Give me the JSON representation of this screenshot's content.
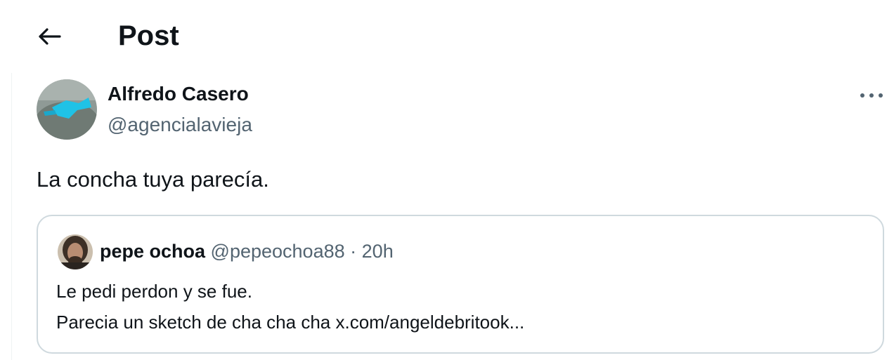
{
  "header": {
    "title": "Post",
    "back_icon": "arrow-left-icon"
  },
  "post": {
    "author_name": "Alfredo Casero",
    "author_handle": "@agencialavieja",
    "text": "La concha tuya parecía.",
    "more_icon": "more-horizontal-icon"
  },
  "quoted": {
    "author_name": "pepe ochoa",
    "author_handle": "@pepeochoa88",
    "separator": "·",
    "time": "20h",
    "line1": "Le pedi perdon y se fue.",
    "line2": "Parecia un sketch de cha cha cha x.com/angeldebritook..."
  },
  "colors": {
    "text_primary": "#0f1419",
    "text_secondary": "#536471",
    "border": "#cfd9de"
  }
}
